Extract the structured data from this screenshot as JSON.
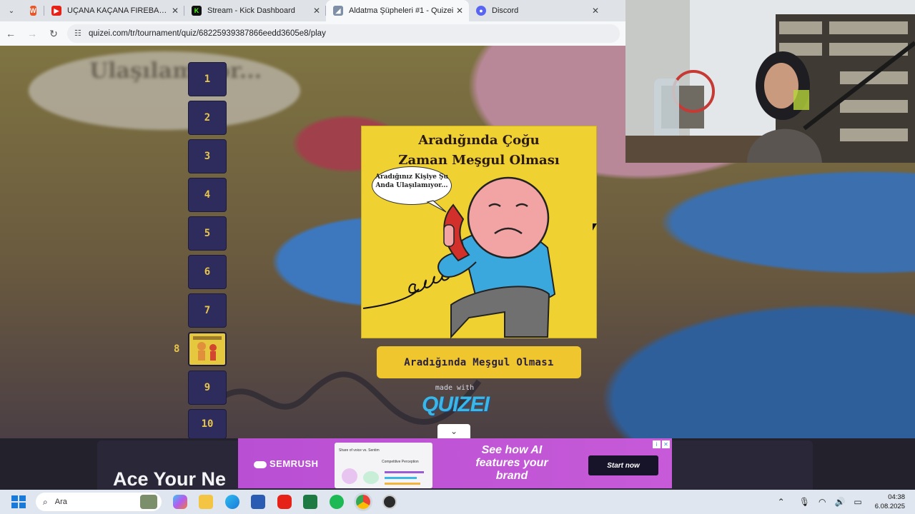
{
  "browser": {
    "tabs": [
      {
        "title": "",
        "icon": "w-office-icon"
      },
      {
        "title": "UÇANA KAÇANA FIREBALLI | M",
        "icon": "youtube-icon"
      },
      {
        "title": "Stream - Kick Dashboard",
        "icon": "kick-icon"
      },
      {
        "title": "Aldatma Şüpheleri #1 - Quizei",
        "icon": "quizei-icon",
        "active": true
      },
      {
        "title": "Discord",
        "icon": "discord-icon"
      }
    ],
    "url": "quizei.com/tr/tournament/quiz/68225939387866eedd3605e8/play"
  },
  "quiz": {
    "rounds": [
      "1",
      "2",
      "3",
      "4",
      "5",
      "6",
      "7",
      "",
      "9",
      "10"
    ],
    "current_round_marker": "8",
    "card_title": "Aradığında Çoğu Zaman Meşgul Olması",
    "card_speech": "Aradığınız Kişiye Şu Anda Ulaşılamıyor...",
    "background_bubble_text": "Ulaşılamıyor...",
    "answer_label": "Aradığında Meşgul Olması",
    "made_with": "made with",
    "brand": "QUIZEI"
  },
  "ads": {
    "ace_text": "Ace Your Ne",
    "semrush_logo": "SEMRUSH",
    "copy": "See how AI features your brand",
    "cta": "Start now",
    "mock_title": "Share of voice vs. Sentim",
    "mock_subtitle": "Competitive Perception"
  },
  "taskbar": {
    "search_placeholder": "Ara",
    "time": "04:38",
    "date": "6.08.2025",
    "apps": [
      "copilot-icon",
      "file-explorer-icon",
      "edge-icon",
      "word-icon",
      "youtube-icon",
      "excel-icon",
      "spotify-icon",
      "chrome-icon",
      "obs-icon"
    ]
  },
  "colors": {
    "round_bg": "#2d2c5d",
    "round_text": "#e8c64c",
    "card_bg": "#f0d132",
    "answer_bg": "#f0c62e",
    "ad_purple": "#c65ad8",
    "brand_blue": "#3ab7e6"
  }
}
